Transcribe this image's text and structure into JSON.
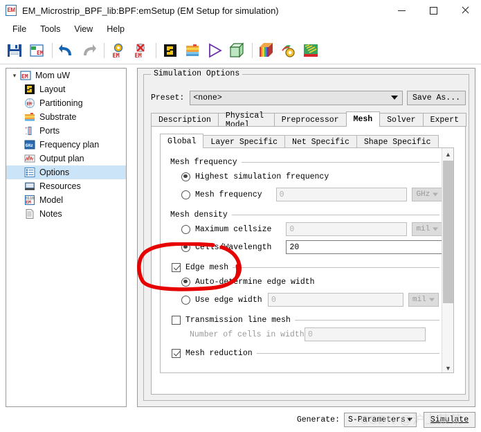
{
  "window": {
    "icon_label": "EM",
    "title": "EM_Microstrip_BPF_lib:BPF:emSetup (EM Setup for simulation)",
    "minimize_label": "Minimize",
    "maximize_label": "Maximize",
    "close_label": "Close"
  },
  "menubar": {
    "items": [
      {
        "label": "File"
      },
      {
        "label": "Tools"
      },
      {
        "label": "View"
      },
      {
        "label": "Help"
      }
    ]
  },
  "toolbar": {
    "buttons": [
      {
        "name": "save-icon",
        "tip": "Save"
      },
      {
        "name": "save-em-setup-icon",
        "tip": "Save EM Setup"
      },
      {
        "name": "undo-icon",
        "tip": "Undo"
      },
      {
        "name": "redo-icon",
        "tip": "Redo"
      },
      {
        "name": "em-simulate-icon",
        "tip": "EM Simulate"
      },
      {
        "name": "em-stop-icon",
        "tip": "Stop EM Simulation"
      },
      {
        "name": "layout-icon",
        "tip": "Layout"
      },
      {
        "name": "substrate-icon",
        "tip": "Substrate"
      },
      {
        "name": "preprocessor-icon",
        "tip": "Preprocessor"
      },
      {
        "name": "mesh-3d-icon",
        "tip": "3D Mesh Viewer"
      },
      {
        "name": "visualization-icon",
        "tip": "EM Visualization"
      },
      {
        "name": "optimization-icon",
        "tip": "Optimization"
      },
      {
        "name": "emds-icon",
        "tip": "EM Model"
      }
    ]
  },
  "tree": {
    "root": {
      "label": "Mom uW",
      "icon": "em-icon",
      "expander": "chevron-down-icon"
    },
    "items": [
      {
        "label": "Layout",
        "icon": "layout-icon",
        "selected": false
      },
      {
        "label": "Partitioning",
        "icon": "partitioning-icon",
        "selected": false
      },
      {
        "label": "Substrate",
        "icon": "substrate-icon",
        "selected": false
      },
      {
        "label": "Ports",
        "icon": "ports-icon",
        "selected": false
      },
      {
        "label": "Frequency plan",
        "icon": "ghz-icon",
        "selected": false
      },
      {
        "label": "Output plan",
        "icon": "output-plan-icon",
        "selected": false
      },
      {
        "label": "Options",
        "icon": "options-icon",
        "selected": true
      },
      {
        "label": "Resources",
        "icon": "resources-icon",
        "selected": false
      },
      {
        "label": "Model",
        "icon": "model-icon",
        "selected": false
      },
      {
        "label": "Notes",
        "icon": "notes-icon",
        "selected": false
      }
    ]
  },
  "main": {
    "group_title": "Simulation Options",
    "preset": {
      "label": "Preset:",
      "value": "<none>",
      "save_as_label": "Save As..."
    },
    "outer_tabs": [
      {
        "label": "Description",
        "active": false
      },
      {
        "label": "Physical Model",
        "active": false
      },
      {
        "label": "Preprocessor",
        "active": false
      },
      {
        "label": "Mesh",
        "active": true
      },
      {
        "label": "Solver",
        "active": false
      },
      {
        "label": "Expert",
        "active": false
      }
    ],
    "inner_tabs": [
      {
        "label": "Global",
        "active": true
      },
      {
        "label": "Layer Specific",
        "active": false
      },
      {
        "label": "Net Specific",
        "active": false
      },
      {
        "label": "Shape Specific",
        "active": false
      }
    ],
    "mesh_frequency": {
      "group_label": "Mesh frequency",
      "option_highest": {
        "label": "Highest simulation frequency",
        "selected": true
      },
      "option_custom": {
        "label": "Mesh frequency",
        "selected": false,
        "value": "0",
        "unit": "GHz"
      }
    },
    "mesh_density": {
      "group_label": "Mesh density",
      "option_cellsize": {
        "label": "Maximum cellsize",
        "selected": false,
        "value": "0",
        "unit": "mil"
      },
      "option_cells_per_wavelength": {
        "label": "Cells/Wavelength",
        "selected": true,
        "value": "20"
      }
    },
    "edge_mesh": {
      "group_label": "Edge mesh",
      "checked": true,
      "option_auto": {
        "label": "Auto-determine edge width",
        "selected": true
      },
      "option_use_width": {
        "label": "Use edge width",
        "selected": false,
        "value": "0",
        "unit": "mil"
      }
    },
    "transmission_line_mesh": {
      "group_label": "Transmission line mesh",
      "checked": false,
      "cells_label": "Number of cells in width",
      "cells_value": "0"
    },
    "mesh_reduction": {
      "group_label": "Mesh reduction",
      "checked": true
    },
    "scrollbar": {
      "up_glyph": "chevron-up-icon",
      "down_glyph": "chevron-down-icon"
    }
  },
  "bottom": {
    "generate_label": "Generate:",
    "generate_value": "S-Parameters",
    "simulate_label": "Simulate"
  },
  "overlay": {
    "watermark_text": "CSDN @沪上某某",
    "annotation_color": "#e60000"
  },
  "colors": {
    "selection_blue": "#cce4f7",
    "panel_gray": "#f0f0f0",
    "border_gray": "#9a9a9a",
    "annotation_red": "#e60000"
  }
}
